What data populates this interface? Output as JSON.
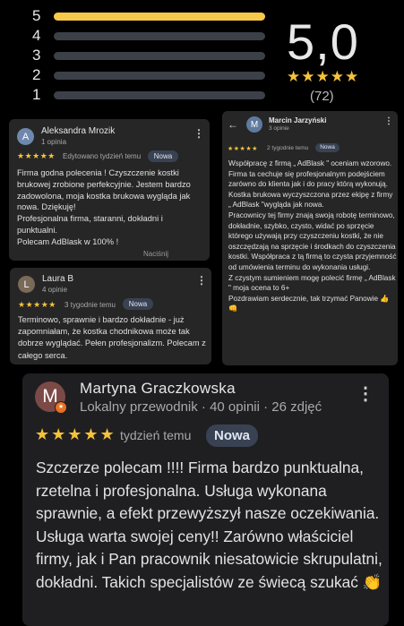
{
  "rating_summary": {
    "rows": [
      {
        "label": "5",
        "fill": 1.0
      },
      {
        "label": "4",
        "fill": 0.0
      },
      {
        "label": "3",
        "fill": 0.0
      },
      {
        "label": "2",
        "fill": 0.0
      },
      {
        "label": "1",
        "fill": 0.0
      }
    ],
    "score": "5,0",
    "stars": "★★★★★",
    "count": "(72)",
    "bar_color": "#f7c94b"
  },
  "reviews": [
    {
      "avatar_letter": "A",
      "name": "Aleksandra Mrozik",
      "meta": "1 opinia",
      "stars": "★★★★★",
      "time": "Edytowano tydzień temu",
      "badge": "Nowa",
      "text": "Firma godna polecenia ! Czyszczenie kostki brukowej zrobione perfekcyjnie. Jestem bardzo zadowolona, moja kostka brukowa wygląda jak nowa. Dziękuję!\nProfesjonalna firma, staranni, dokładni i punktualni.\nPolecam AdBlask w 100% !",
      "extra": "Naciśnij"
    },
    {
      "avatar_letter": "L",
      "name": "Laura B",
      "meta": "4 opinie",
      "stars": "★★★★★",
      "time": "3 tygodnie temu",
      "badge": "Nowa",
      "text": "Terminowo, sprawnie i bardzo dokładnie - już zapomniałam, że kostka chodnikowa może tak dobrze wyglądać. Pełen profesjonalizm. Polecam z całego serca."
    },
    {
      "avatar_letter": "M",
      "name": "Marcin Jarzyński",
      "meta": "3 opinie",
      "stars": "★★★★★",
      "time": "2 tygodnie temu",
      "badge": "Nowa",
      "text": "Współpracę z firmą „ AdBlask \" oceniam wzorowo. Firma ta cechuje się profesjonalnym podejściem zarówno do klienta jak i do pracy którą wykonują. Kostka brukowa wyczyszczona przez ekipę z firmy „ AdBlask \"wygląda jak nowa.\nPracownicy tej firmy znają swoją robotę terminowo, dokładnie, szybko, czysto, widać po sprzęcie którego używają przy czyszczeniu kostki, że nie oszczędzają na sprzęcie i środkach do czyszczenia kostki. Współpraca z tą firmą to czysta przyjemność od umówienia terminu do wykonania usługi.\nZ czystym sumieniem mogę polecić firmę „ AdBlask \" moja ocena to 6+\nPozdrawiam serdecznie, tak trzymać Panowie 👍👊"
    },
    {
      "avatar_letter": "M",
      "name": "Martyna Graczkowska",
      "meta": "Lokalny przewodnik · 40 opinii · 26 zdjęć",
      "stars": "★★★★★",
      "time": "tydzień temu",
      "badge": "Nowa",
      "text": "Szczerze polecam !!!! Firma bardzo punktualna, rzetelna i profesjonalna. Usługa wykonana sprawnie, a efekt przewyższył nasze oczekiwania. Usługa warta swojej ceny!! Zarówno właściciel firmy, jak i Pan pracownik niesatowicie skrupulatni, dokładni. Takich specjalistów ze świecą szukać 👏"
    }
  ],
  "icons": {
    "more": "⋮",
    "back": "←",
    "guide_badge": "★"
  }
}
